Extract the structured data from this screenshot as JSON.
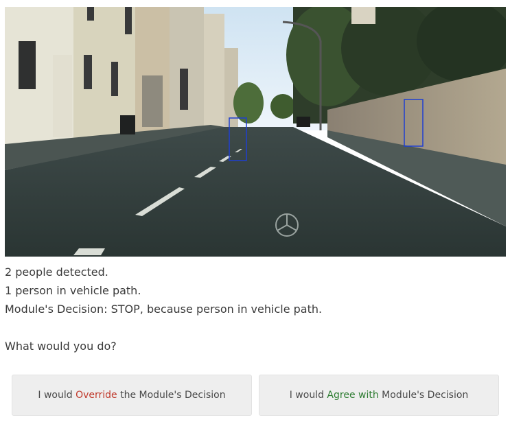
{
  "detections": {
    "summary": "2 people detected.",
    "in_path": "1 person in vehicle path.",
    "decision": "Module's Decision: STOP, because person in vehicle path."
  },
  "prompt": "What would you do?",
  "buttons": {
    "override": {
      "prefix": "I would ",
      "highlight": "Override",
      "suffix": " the Module's Decision",
      "highlight_color": "#c0392b"
    },
    "agree": {
      "prefix": "I would ",
      "highlight": "Agree with",
      "suffix": " Module's Decision",
      "highlight_color": "#2e7d32"
    }
  },
  "colors": {
    "bounding_box": "#1f3fd1",
    "button_bg": "#eeeeee",
    "body_text": "#3a3a3a"
  }
}
